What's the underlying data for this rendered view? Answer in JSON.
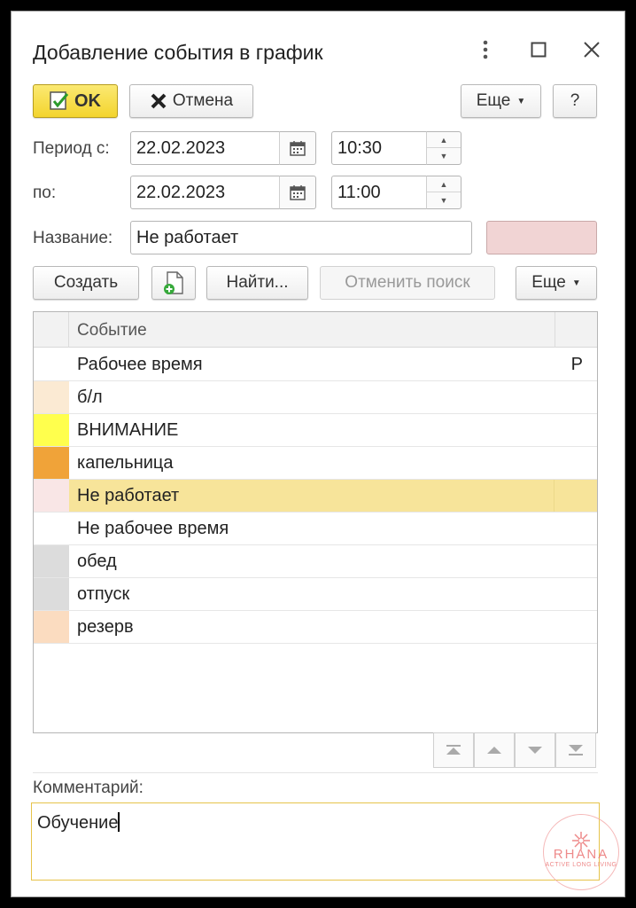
{
  "window": {
    "title": "Добавление события в график"
  },
  "toolbar": {
    "ok_label": "OK",
    "cancel_label": "Отмена",
    "more_label": "Еще",
    "help_label": "?"
  },
  "period": {
    "from_label": "Период с:",
    "from_date": "22.02.2023",
    "from_time": "10:30",
    "to_label": "по:",
    "to_date": "22.02.2023",
    "to_time": "11:00"
  },
  "name": {
    "label": "Название:",
    "value": "Не работает",
    "color": "#f1d4d4"
  },
  "actions": {
    "create_label": "Создать",
    "find_label": "Найти...",
    "cancel_search_label": "Отменить поиск",
    "more_label": "Еще"
  },
  "table": {
    "header": "Событие",
    "rows": [
      {
        "name": "Рабочее время",
        "color": "#ffffff",
        "flag": "Р",
        "selected": false
      },
      {
        "name": "б/л",
        "color": "#fbead3",
        "flag": "",
        "selected": false
      },
      {
        "name": "ВНИМАНИЕ",
        "color": "#ffff4d",
        "flag": "",
        "selected": false
      },
      {
        "name": "капельница",
        "color": "#f0a339",
        "flag": "",
        "selected": false
      },
      {
        "name": "Не работает",
        "color": "#f9e6e6",
        "flag": "",
        "selected": true
      },
      {
        "name": "Не рабочее время",
        "color": "#ffffff",
        "flag": "",
        "selected": false
      },
      {
        "name": "обед",
        "color": "#dcdcdc",
        "flag": "",
        "selected": false
      },
      {
        "name": "отпуск",
        "color": "#dcdcdc",
        "flag": "",
        "selected": false
      },
      {
        "name": "резерв",
        "color": "#fbdcc0",
        "flag": "",
        "selected": false
      }
    ]
  },
  "comment": {
    "label": "Комментарий:",
    "value": "Обучение"
  },
  "watermark": {
    "brand": "RHANA",
    "tagline": "ACTIVE LONG LIVING"
  },
  "colors": {
    "accent_yellow": "#f5d832",
    "selection": "#f7e49a",
    "focus_border": "#e6c34a"
  }
}
